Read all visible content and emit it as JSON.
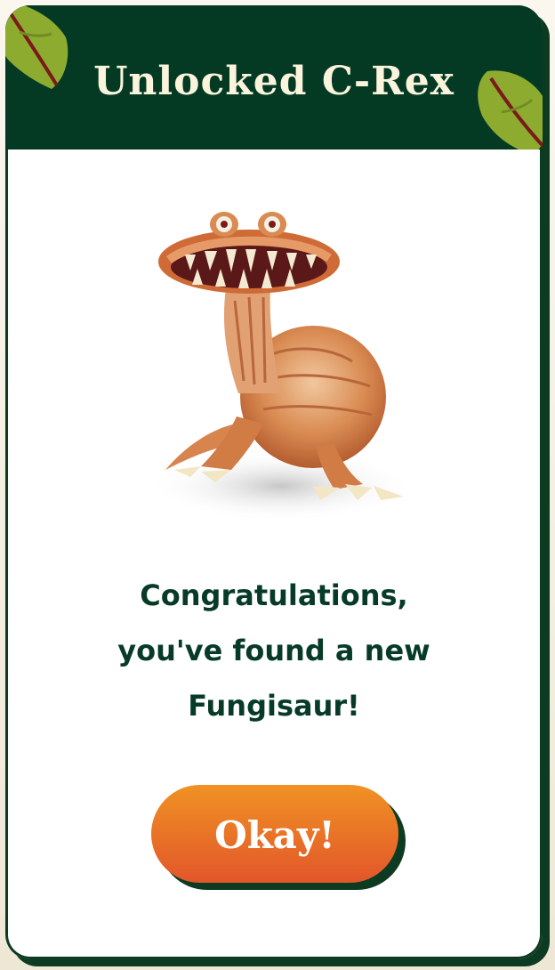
{
  "dialog": {
    "title": "Unlocked C-Rex",
    "message_lines": [
      "Congratulations,",
      "you've found a new",
      "Fungisaur!"
    ],
    "button_label": "Okay!"
  },
  "colors": {
    "header_bg": "#043a24",
    "title_text": "#fbf4dd",
    "message_text": "#073b27",
    "button_top": "#f09224",
    "button_bottom": "#e2562a",
    "leaf_green": "#8cab2f",
    "leaf_vein": "#7a1a1a"
  },
  "icons": {
    "header_leaves": "leaf-icon",
    "creature": "c-rex-illustration"
  }
}
